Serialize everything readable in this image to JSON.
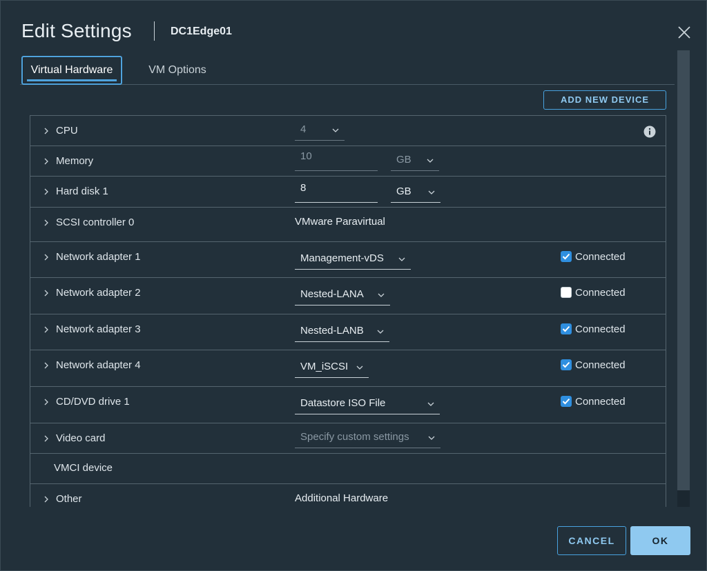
{
  "dialog": {
    "title": "Edit Settings",
    "subtitle": "DC1Edge01",
    "close_icon": "close-icon"
  },
  "tabs": [
    {
      "label": "Virtual Hardware",
      "active": true
    },
    {
      "label": "VM Options",
      "active": false
    }
  ],
  "toolbar": {
    "add_device_label": "ADD NEW DEVICE"
  },
  "hardware": {
    "cpu": {
      "label": "CPU",
      "value": "4"
    },
    "memory": {
      "label": "Memory",
      "value": "10",
      "unit": "GB"
    },
    "hard_disk": {
      "label": "Hard disk 1",
      "value": "8",
      "unit": "GB"
    },
    "scsi": {
      "label": "SCSI controller 0",
      "value": "VMware Paravirtual"
    },
    "net1": {
      "label": "Network adapter 1",
      "network": "Management-vDS",
      "connected": true,
      "connected_label": "Connected"
    },
    "net2": {
      "label": "Network adapter 2",
      "network": "Nested-LANA",
      "connected": false,
      "connected_label": "Connected"
    },
    "net3": {
      "label": "Network adapter 3",
      "network": "Nested-LANB",
      "connected": true,
      "connected_label": "Connected"
    },
    "net4": {
      "label": "Network adapter 4",
      "network": "VM_iSCSI",
      "connected": true,
      "connected_label": "Connected"
    },
    "cd": {
      "label": "CD/DVD drive 1",
      "value": "Datastore ISO File",
      "connected": true,
      "connected_label": "Connected"
    },
    "video": {
      "label": "Video card",
      "value": "Specify custom settings"
    },
    "vmci": {
      "label": "VMCI device"
    },
    "other": {
      "label": "Other",
      "value": "Additional Hardware"
    }
  },
  "footer": {
    "cancel_label": "CANCEL",
    "ok_label": "OK"
  },
  "colors": {
    "accent": "#49a3e0",
    "background": "#22303a",
    "checkbox": "#2f8fe0"
  }
}
